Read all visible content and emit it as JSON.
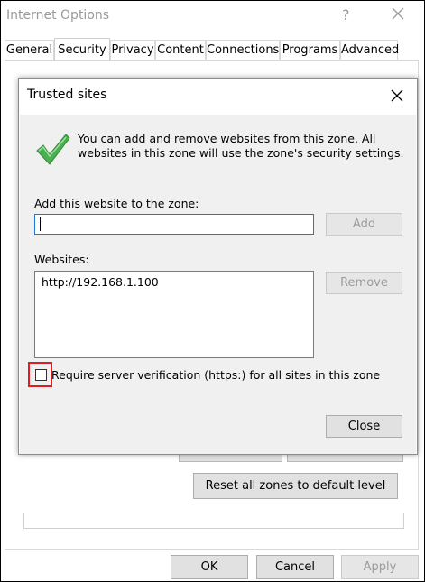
{
  "window": {
    "title": "Internet Options",
    "help_glyph": "?",
    "tabs": [
      {
        "label": "General"
      },
      {
        "label": "Security"
      },
      {
        "label": "Privacy"
      },
      {
        "label": "Content"
      },
      {
        "label": "Connections"
      },
      {
        "label": "Programs"
      },
      {
        "label": "Advanced"
      }
    ],
    "active_tab": "Security",
    "reset_button_label": "Reset all zones to default level",
    "footer": {
      "ok_label": "OK",
      "cancel_label": "Cancel",
      "apply_label": "Apply"
    }
  },
  "dialog": {
    "title": "Trusted sites",
    "info_text": "You can add and remove websites from this zone. All websites in this zone will use the zone's security settings.",
    "add_label": "Add this website to the zone:",
    "add_input_value": "",
    "add_button_label": "Add",
    "websites_label": "Websites:",
    "websites": [
      "http://192.168.1.100"
    ],
    "remove_button_label": "Remove",
    "require_https_label": "Require server verification (https:) for all sites in this zone",
    "require_https_checked": false,
    "close_button_label": "Close"
  },
  "colors": {
    "highlight": "#e01b22",
    "check_green": "#4caf50",
    "input_focus_border": "#1e78d7"
  }
}
